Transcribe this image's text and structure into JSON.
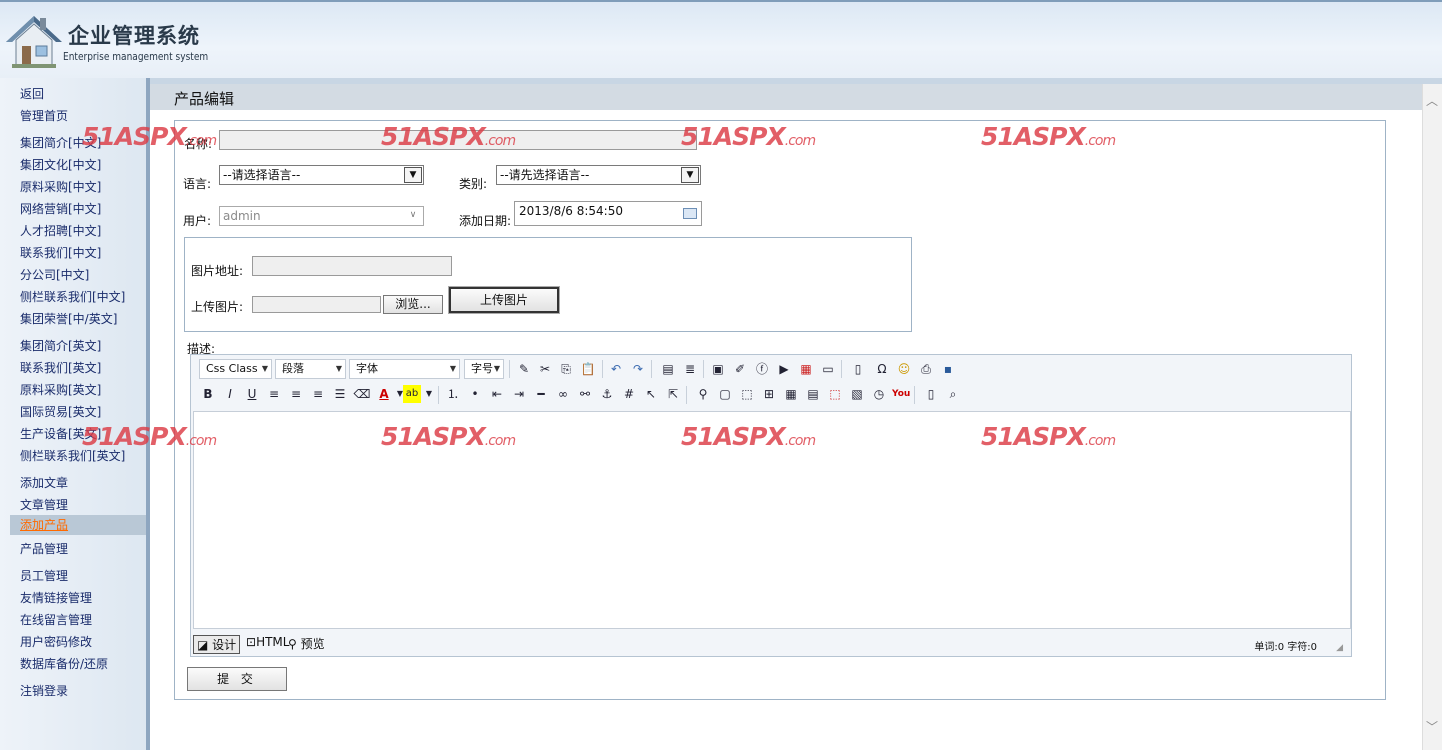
{
  "header": {
    "title_cn": "企业管理系统",
    "title_en": "Enterprise management system"
  },
  "nav": [
    {
      "label": "返回"
    },
    {
      "label": "管理首页"
    },
    {
      "label": "集团简介[中文]"
    },
    {
      "label": "集团文化[中文]"
    },
    {
      "label": "原料采购[中文]"
    },
    {
      "label": "网络营销[中文]"
    },
    {
      "label": "人才招聘[中文]"
    },
    {
      "label": "联系我们[中文]"
    },
    {
      "label": "分公司[中文]"
    },
    {
      "label": "侧栏联系我们[中文]"
    },
    {
      "label": "集团荣誉[中/英文]"
    },
    {
      "label": "集团简介[英文]"
    },
    {
      "label": "联系我们[英文]"
    },
    {
      "label": "原料采购[英文]"
    },
    {
      "label": "国际贸易[英文]"
    },
    {
      "label": "生产设备[英文]"
    },
    {
      "label": "侧栏联系我们[英文]"
    },
    {
      "label": "添加文章"
    },
    {
      "label": "文章管理"
    },
    {
      "label": "添加产品"
    },
    {
      "label": "产品管理"
    },
    {
      "label": "员工管理"
    },
    {
      "label": "友情链接管理"
    },
    {
      "label": "在线留言管理"
    },
    {
      "label": "用户密码修改"
    },
    {
      "label": "数据库备份/还原"
    },
    {
      "label": "注销登录"
    }
  ],
  "page": {
    "title": "产品编辑"
  },
  "form": {
    "name_label": "名称:",
    "name_value": "",
    "lang_label": "语言:",
    "lang_value": "--请选择语言--",
    "cat_label": "类别:",
    "cat_value": "--请先选择语言--",
    "user_label": "用户:",
    "user_value": "admin",
    "date_label": "添加日期:",
    "date_value": "2013/8/6 8:54:50",
    "img_url_label": "图片地址:",
    "img_url_value": "",
    "upload_label": "上传图片:",
    "browse_label": "浏览...",
    "upload_button": "上传图片",
    "desc_label": "描述:",
    "submit_label": "提  交"
  },
  "editor": {
    "css_class": "Css Class",
    "paragraph": "段落",
    "font": "字体",
    "font_size": "字号",
    "design_tab": "设计",
    "html_tab": "HTML",
    "preview_tab": "预览",
    "stats": "单词:0 字符:0"
  },
  "watermark": {
    "brand": "51ASPX",
    "suffix": ".com"
  },
  "colors": {
    "active_nav": "#ff6a00",
    "nav_text": "#1a2c6b",
    "watermark": "#dc3c46"
  }
}
